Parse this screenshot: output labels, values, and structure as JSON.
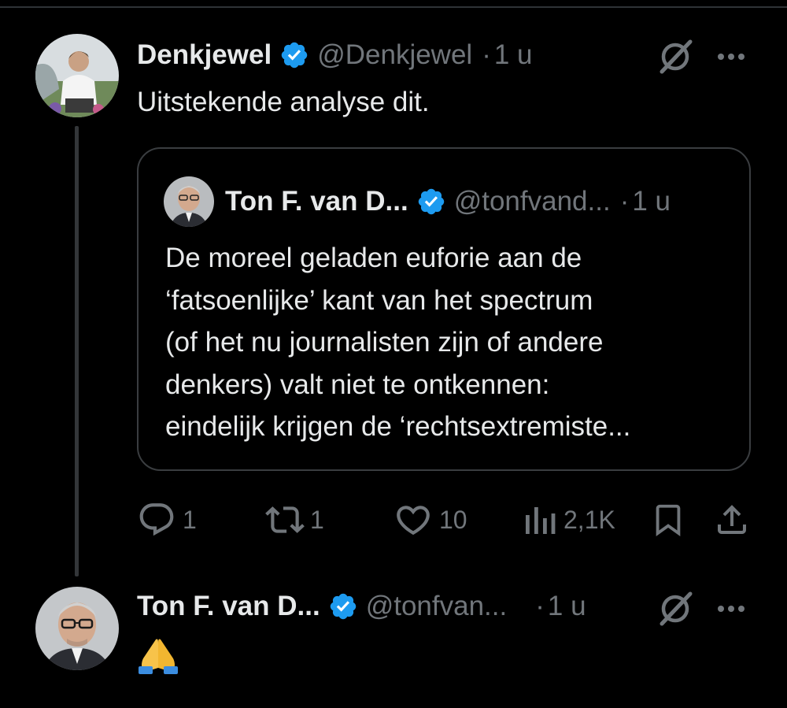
{
  "tweets": [
    {
      "author_name": "Denkjewel",
      "handle": "@Denkjewel",
      "separator": "·",
      "time": "1 u",
      "text": "Uitstekende analyse dit.",
      "quote": {
        "author_name": "Ton F. van D...",
        "handle": "@tonfvand...",
        "separator": "·",
        "time": "1 u",
        "lines": [
          "De moreel geladen euforie aan de",
          "‘fatsoenlijke’ kant van het spectrum",
          "(of het nu journalisten zijn of andere",
          "denkers) valt niet te ontkennen:",
          "eindelijk krijgen de ‘rechtsextremiste..."
        ]
      },
      "actions": {
        "replies": "1",
        "reposts": "1",
        "likes": "10",
        "views": "2,1K"
      }
    },
    {
      "author_name": "Ton F. van D...",
      "handle": "@tonfvan...",
      "separator": "·",
      "time": "1 u",
      "text_emoji": "folded-hands-emoji"
    }
  ],
  "icons": {
    "verified": "verified-badge-icon",
    "grok": "grok-icon",
    "more": "more-options-icon",
    "reply": "reply-icon",
    "repost": "repost-icon",
    "like": "like-icon",
    "views": "views-icon",
    "bookmark": "bookmark-icon",
    "share": "share-icon"
  },
  "colors": {
    "background": "#000000",
    "text": "#e7e9ea",
    "secondary": "#71767b",
    "verified": "#1d9bf0",
    "border": "#3a3d40"
  }
}
